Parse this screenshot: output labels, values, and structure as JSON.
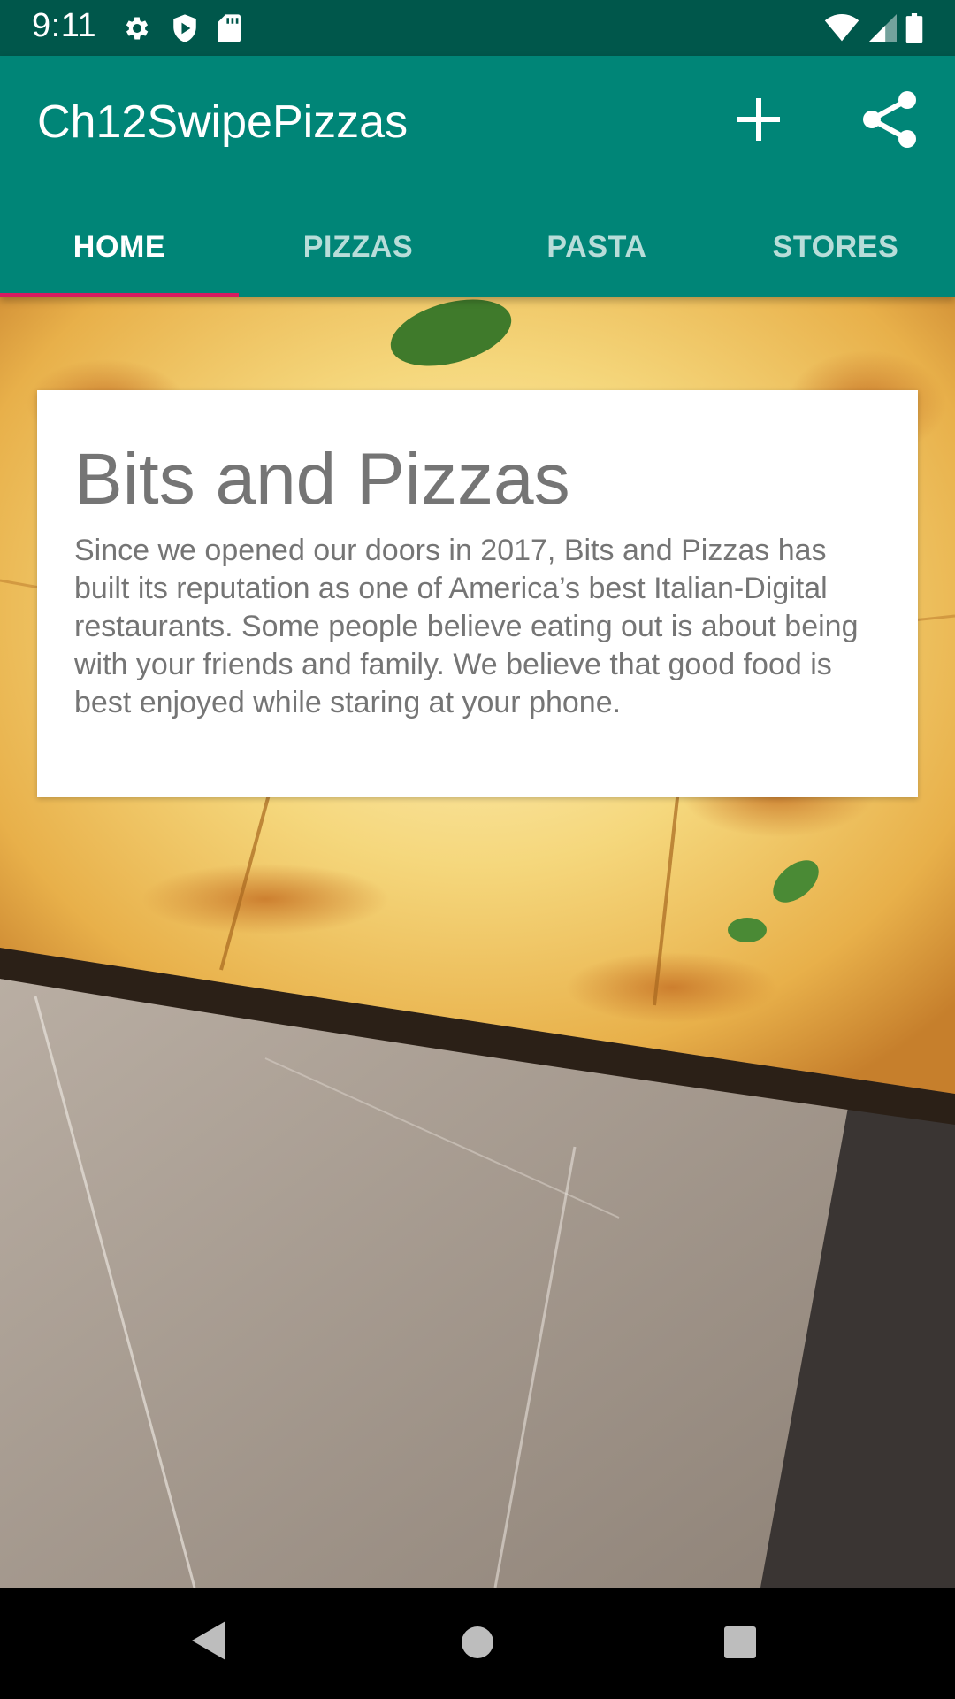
{
  "status_bar": {
    "time": "9:11",
    "icons": [
      "gear-icon",
      "shield-play-icon",
      "sd-card-icon",
      "wifi-icon",
      "signal-icon",
      "battery-icon"
    ]
  },
  "app_bar": {
    "title": "Ch12SwipePizzas",
    "actions": [
      "add-icon",
      "share-icon"
    ]
  },
  "tabs": [
    {
      "label": "HOME",
      "active": true
    },
    {
      "label": "PIZZAS",
      "active": false
    },
    {
      "label": "PASTA",
      "active": false
    },
    {
      "label": "STORES",
      "active": false
    }
  ],
  "card": {
    "title": "Bits and Pizzas",
    "body": "Since we opened our doors in 2017, Bits and Pizzas has built its reputation as one of America’s best Italian-Digital restaurants. Some people believe eating out is about being with your friends and family. We believe that good food is best enjoyed while staring at your phone."
  },
  "nav_bar": {
    "icons": [
      "back-icon",
      "home-icon",
      "recents-icon"
    ]
  },
  "colors": {
    "status_bar": "#00574b",
    "primary": "#008577",
    "accent": "#d81b60"
  }
}
